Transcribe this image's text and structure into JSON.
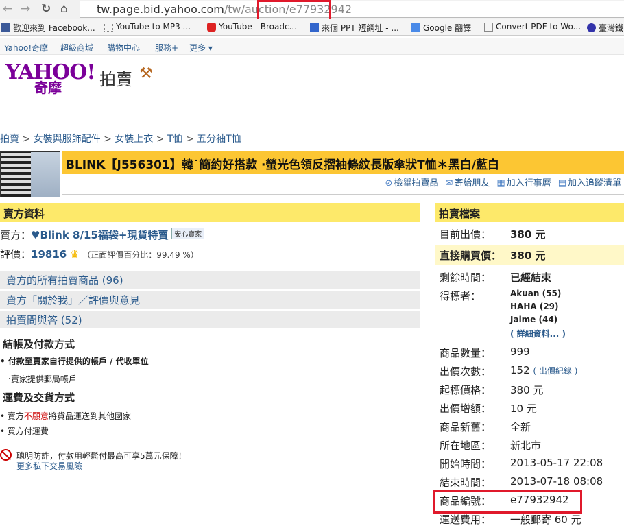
{
  "browser": {
    "url_host": "tw.page.bid.yahoo.com",
    "url_path": "/tw/auction",
    "url_id": "/e77932942",
    "bookmarks": [
      "歡迎來到 Facebook...",
      "YouTube to MP3 ...",
      "YouTube - Broadc...",
      "來個 PPT 短網址 - ...",
      "Google 翻譯",
      "Convert PDF to Wo...",
      "臺灣鐵"
    ]
  },
  "ynav": [
    "Yahoo!奇摩",
    "超級商城",
    "購物中心",
    "服務+",
    "更多 ▾"
  ],
  "logo": {
    "text": "YAHOO!",
    "sub": "奇摩",
    "section": "拍賣"
  },
  "breadcrumb": [
    "拍賣",
    "女裝與服飾配件",
    "女裝上衣",
    "T恤",
    "五分袖T恤"
  ],
  "title": "BLINK【J556301】韓˙簡約好搭款 ‧螢光色領反摺袖條紋長版傘狀T恤＊黑白/藍白",
  "actions": [
    "檢舉拍賣品",
    "寄給朋友",
    "加入行事曆",
    "加入追蹤清單"
  ],
  "seller": {
    "header": "賣方資料",
    "label": "賣方：",
    "name": "♥Blink 8/15福袋+現貨特賣",
    "badge": "安心賣家",
    "rating_label": "評價：",
    "rating": "19816",
    "positive": "（正面評價百分比：99.49 %）",
    "links": [
      "賣方的所有拍賣商品 (96)",
      "賣方「關於我」／評價與意見",
      "拍賣問與答 (52)"
    ]
  },
  "payment": {
    "title": "結帳及付款方式",
    "item": "付款至賣家自行提供的帳戶 / 代收單位",
    "sub": "‧賣家提供郵局帳戶"
  },
  "shipping": {
    "title": "運費及交貨方式",
    "item1_a": "賣方",
    "item1_red": "不願意",
    "item1_b": "將貨品運送到其他國家",
    "item2": "買方付運費"
  },
  "warning": {
    "text": "聰明防詐，付款用輕鬆付最高可享5萬元保障！",
    "link": "更多私下交易風險"
  },
  "auction": {
    "header": "拍賣檔案",
    "current_label": "目前出價：",
    "current": "380 元",
    "buynow_label": "直接購買價：",
    "buynow": "380 元",
    "remaining_label": "剩餘時間：",
    "remaining": "已經結束",
    "winners_label": "得標者：",
    "winners": [
      "Akuan (55)",
      "HAHA (29)",
      "Jaime (44)"
    ],
    "winners_more": "( 詳細資料... )",
    "rows": [
      {
        "k": "商品數量：",
        "v": "999"
      },
      {
        "k": "出價次數：",
        "v": "152",
        "link": "( 出價紀錄 )"
      },
      {
        "k": "起標價格：",
        "v": "380 元"
      },
      {
        "k": "出價增額：",
        "v": "10 元"
      },
      {
        "k": "商品新舊：",
        "v": "全新"
      },
      {
        "k": "所在地區：",
        "v": "新北市"
      },
      {
        "k": "開始時間：",
        "v": "2013-05-17 22:08"
      },
      {
        "k": "結束時間：",
        "v": "2013-07-18 08:08"
      },
      {
        "k": "商品編號：",
        "v": "e77932942"
      },
      {
        "k": "運送費用：",
        "v": "一般郵寄 60 元"
      }
    ]
  },
  "colors": {
    "highlight_box": "#e0192b",
    "title_bar": "#fcc633",
    "section_bar": "#fde96a",
    "link": "#2a5a8c"
  }
}
